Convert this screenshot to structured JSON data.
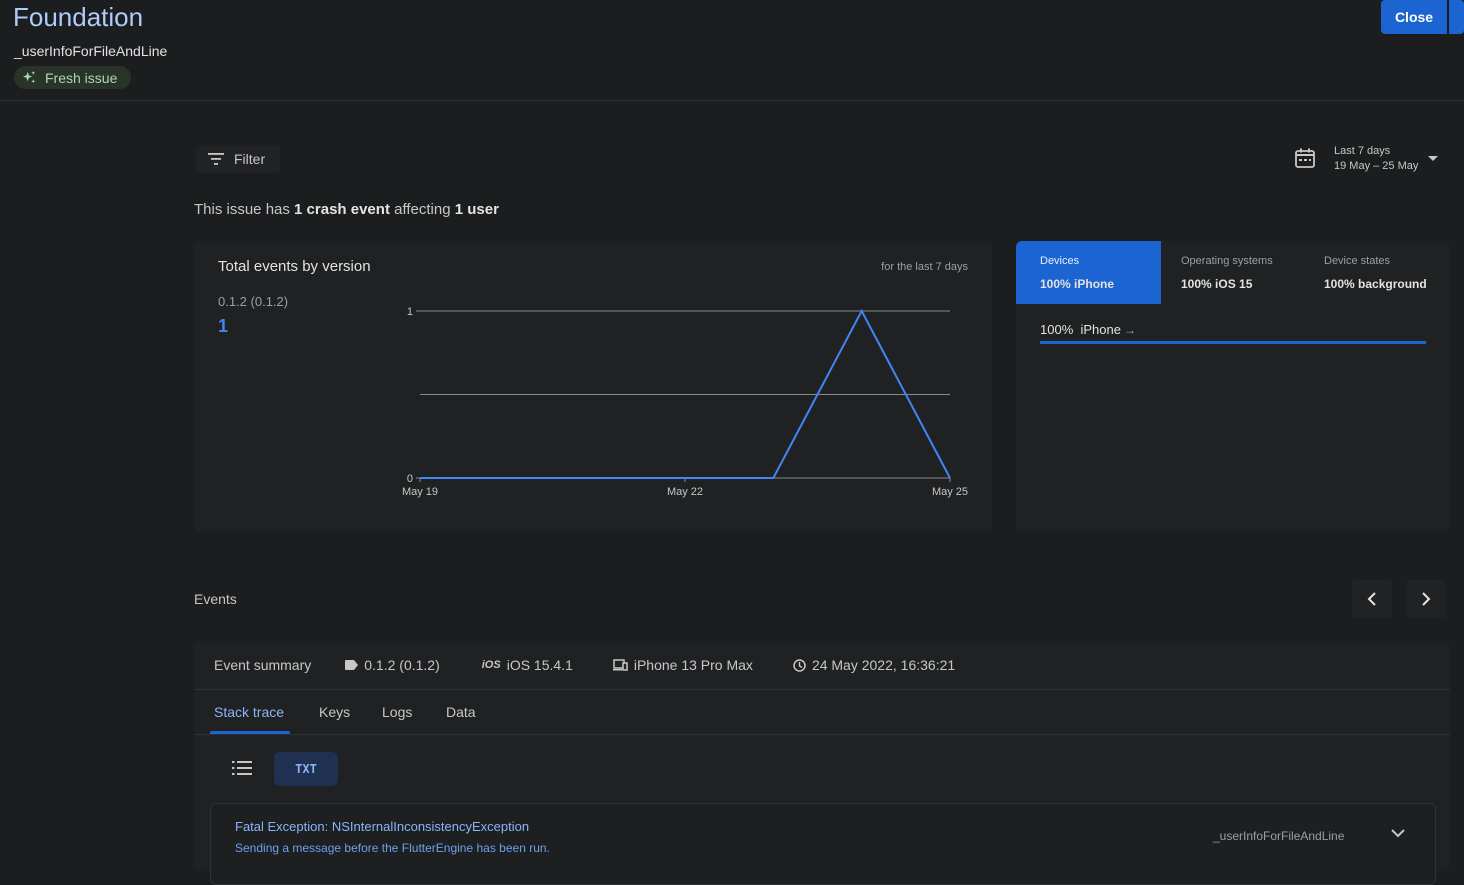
{
  "header": {
    "title": "Foundation",
    "subtitle": "_userInfoForFileAndLine",
    "badge": "Fresh issue",
    "close_label": "Close"
  },
  "toolbar": {
    "filter_label": "Filter",
    "date_range_label": "Last 7 days",
    "date_range_value": "19 May – 25 May"
  },
  "summary": {
    "prefix": "This issue has",
    "crash_count": "1 crash event",
    "middle": "affecting",
    "user_count": "1 user"
  },
  "version_chart": {
    "title": "Total events by version",
    "range_note": "for the last 7 days",
    "version_label": "0.1.2 (0.1.2)",
    "version_count": "1"
  },
  "chart_data": {
    "type": "line",
    "title": "Total events by version",
    "x": [
      "May 19",
      "May 20",
      "May 21",
      "May 22",
      "May 23",
      "May 24",
      "May 25"
    ],
    "x_tick_labels": [
      "May 19",
      "May 22",
      "May 25"
    ],
    "series": [
      {
        "name": "0.1.2 (0.1.2)",
        "values": [
          0,
          0,
          0,
          0,
          0,
          1,
          0
        ],
        "color": "#4285f4"
      }
    ],
    "y_tick_labels": [
      "1",
      "0"
    ],
    "ylim": [
      0,
      1
    ],
    "grid": true
  },
  "devices": {
    "tabs": [
      {
        "heading": "Devices",
        "value": "100% iPhone"
      },
      {
        "heading": "Operating systems",
        "value": "100% iOS 15"
      },
      {
        "heading": "Device states",
        "value": "100% background"
      }
    ],
    "rows": [
      {
        "percent_label": "100%",
        "name": "iPhone",
        "fraction": 1.0
      }
    ]
  },
  "events": {
    "label": "Events",
    "summary_label": "Event summary",
    "version": "0.1.2 (0.1.2)",
    "os_badge": "iOS",
    "os": "iOS 15.4.1",
    "device": "iPhone 13 Pro Max",
    "timestamp": "24 May 2022, 16:36:21",
    "tabs": [
      "Stack trace",
      "Keys",
      "Logs",
      "Data"
    ],
    "format_label": "TXT",
    "exception_title": "Fatal Exception: NSInternalInconsistencyException",
    "exception_message": "Sending a message before the FlutterEngine has been run.",
    "exception_source": "_userInfoForFileAndLine"
  },
  "colors": {
    "accent": "#1c64d1",
    "link": "#8ab4f8",
    "series": "#4285f4",
    "background": "#1b1d1f"
  }
}
